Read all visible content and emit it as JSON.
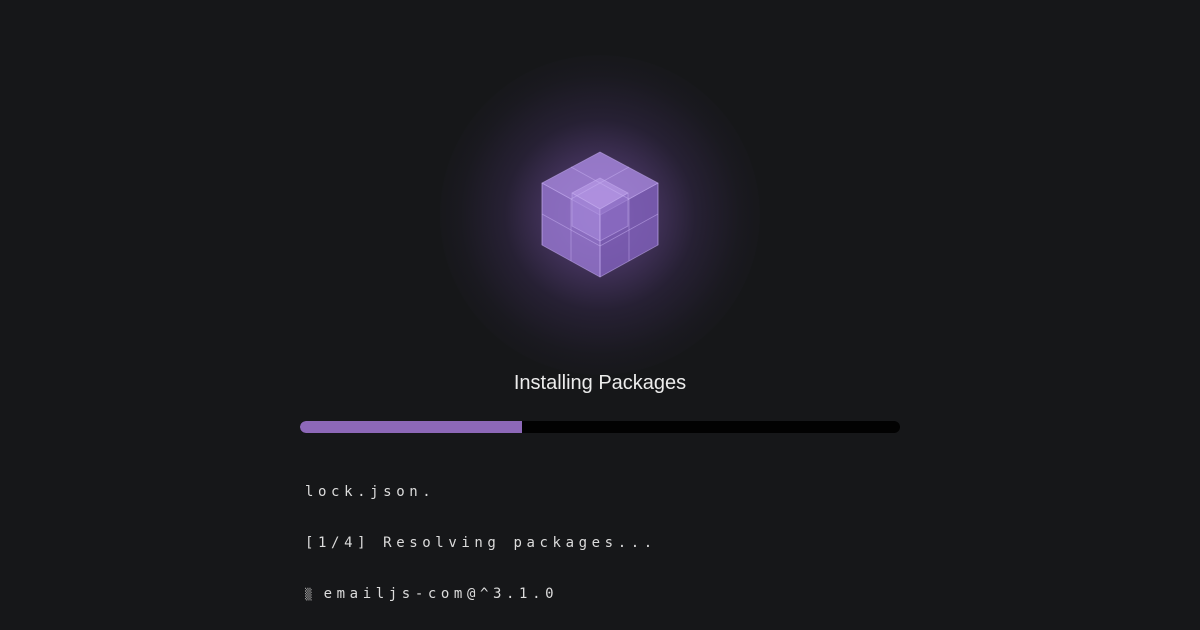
{
  "title": "Installing Packages",
  "progress": {
    "fraction": 0.37,
    "fill_color": "#8d68b8",
    "track_color": "#020202"
  },
  "log": {
    "lines": [
      "lock.json.",
      "[1/4] Resolving packages..."
    ],
    "spinner_glyph": "▒",
    "current_package": "emailjs-com@^3.1.0"
  },
  "icon": {
    "name": "package-cube-icon",
    "color": "#9b77d4"
  },
  "background_color": "#161719"
}
